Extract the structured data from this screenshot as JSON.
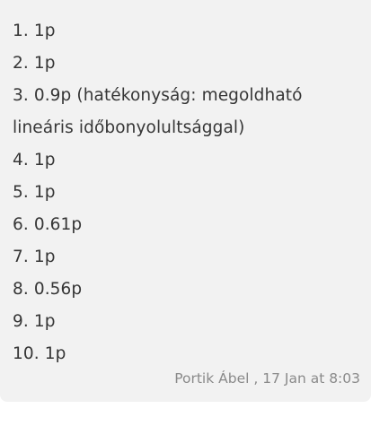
{
  "comment": {
    "lines": [
      "1. 1p",
      "2. 1p",
      "3. 0.9p (hatékonyság: megoldható",
      "lineáris időbonyolultsággal)",
      "4. 1p",
      "5. 1p",
      "6. 0.61p",
      "7. 1p",
      "8. 0.56p",
      "9. 1p",
      "10. 1p"
    ],
    "author": "Portik Ábel",
    "date_separator": " , ",
    "timestamp": "17 Jan at 8:03"
  }
}
